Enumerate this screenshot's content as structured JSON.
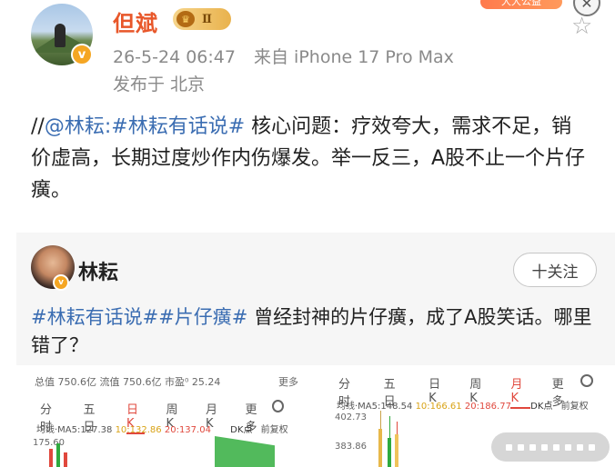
{
  "post": {
    "username": "但斌",
    "level_badge": "Ⅱ",
    "fav_tag": "大大公益",
    "timestamp": "26-5-24 06:47",
    "device": "来自 iPhone 17 Pro Max",
    "location": "发布于 北京",
    "text_prefix": "//",
    "text_mention": "@林耘",
    "text_colon": ":",
    "text_hashtag": "#林耘有话说#",
    "text_body": " 核心问题：疗效夸大，需求不足，销价虚高，长期过度炒作内伤爆发。举一反三，A股不止一个片仔癀。"
  },
  "quote": {
    "name": "林耘",
    "follow_label": "十关注",
    "hashtag1": "#林耘有话说#",
    "hashtag2": "#片仔癀#",
    "text_body": " 曾经封神的片仔癀，成了A股笑话。哪里错了？"
  },
  "stock_left": {
    "info": "总值 750.6亿  流值 750.6亿  市盈⁰ 25.24",
    "more": "更多",
    "tabs": [
      "分时",
      "五日",
      "日K",
      "周K",
      "月K",
      "更多"
    ],
    "active_tab": "日K",
    "ma_label": "均线·MA5:127.38",
    "ma10": "10:132.86",
    "ma20": "20:137.04",
    "dk": "DK点",
    "fq": "前复权",
    "price_top": "175.60"
  },
  "stock_right": {
    "tabs": [
      "分时",
      "五日",
      "日K",
      "周K",
      "月K",
      "更多"
    ],
    "active_tab": "月K",
    "ma_label": "均线·MA5:148.54",
    "ma10": "10:166.61",
    "ma20": "20:186.77",
    "dk": "DK点",
    "fq": "前复权",
    "price_top": "402.73",
    "price_mid": "383.86"
  },
  "colors": {
    "username": "#e8572a",
    "link": "#3b6db2",
    "up": "#e0483d",
    "down": "#2faa3f"
  }
}
